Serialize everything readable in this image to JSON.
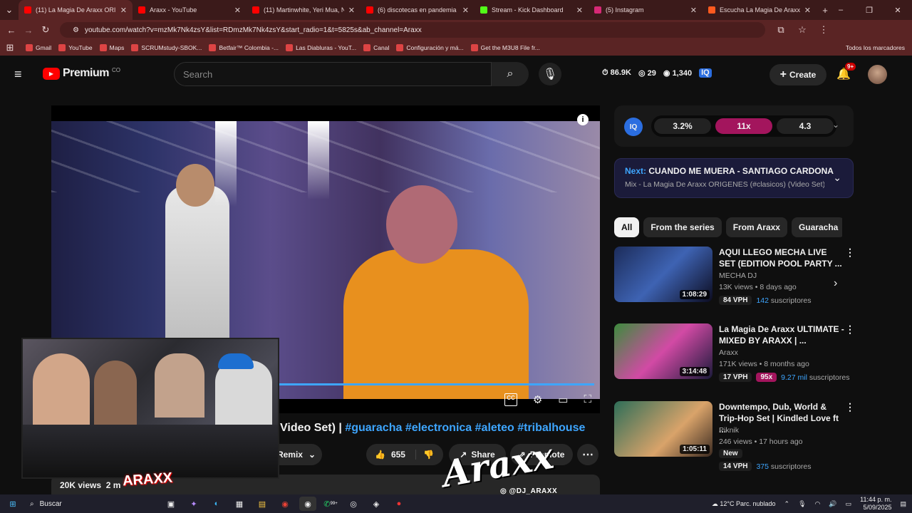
{
  "browser": {
    "tabs": [
      {
        "title": "(11) La Magia De Araxx ORI",
        "color": "#ff0000"
      },
      {
        "title": "Araxx - YouTube",
        "color": "#ff0000"
      },
      {
        "title": "(11) Martinwhite, Yeri Mua, NE",
        "color": "#ff0000"
      },
      {
        "title": "(6) discotecas en pandemia bo",
        "color": "#ff0000"
      },
      {
        "title": "Stream - Kick Dashboard",
        "color": "#53fc18"
      },
      {
        "title": "(5) Instagram",
        "color": "#d62976"
      },
      {
        "title": "Escucha La Magia De Araxx ULT",
        "color": "#ff5a1f"
      }
    ],
    "url": "youtube.com/watch?v=mzMk7Nk4zsY&list=RDmzMk7Nk4zsY&start_radio=1&t=5825s&ab_channel=Araxx",
    "bookmarks": [
      "Gmail",
      "YouTube",
      "Maps",
      "SCRUMstudy-SBOK...",
      "Betfair™ Colombia -...",
      "Las Diabluras - YouT...",
      "Canal",
      "Configuración y má...",
      "Get the M3U8 File fr..."
    ],
    "all_bookmarks": "Todos los marcadores"
  },
  "yt": {
    "logo": "Premium",
    "country": "CO",
    "search_placeholder": "Search",
    "stats": {
      "views": "86.9K",
      "likes": "29",
      "eye": "1,340"
    },
    "create": "Create",
    "notif": "9+"
  },
  "iq": {
    "badge": "IQ",
    "a": "3.2%",
    "b": "11x",
    "c": "4.3"
  },
  "next": {
    "label": "Next:",
    "title": "CUANDO ME MUERA - SANTIAGO CARDONA",
    "sub": "Mix - La Magia De Araxx ORIGENES (#clasicos) (Video Set) | ..."
  },
  "chips": [
    "All",
    "From the series",
    "From Araxx",
    "Guaracha"
  ],
  "video": {
    "title_tail": "Video Set) |",
    "hashtags": "#guaracha #electronica #aleteo #tribalhouse",
    "likes": "655",
    "share": "Share",
    "promote": "Promote",
    "remix": "Remix",
    "views": "20K views",
    "ago": "2 m",
    "watermark": "Araxx",
    "handle": "@DJ_ARAXX"
  },
  "recs": [
    {
      "title": "AQUI LLEGO MECHA LIVE SET (EDITION POOL PARTY ...",
      "channel": "MECHA DJ",
      "meta": "13K views • 8 days ago",
      "dur": "1:08:29",
      "vph": "84 VPH",
      "extra": "",
      "subs": "142",
      "subs_label": "suscriptores"
    },
    {
      "title": "La Magia De Araxx ULTIMATE - MIXED BY ARAXX | ...",
      "channel": "Araxx",
      "meta": "171K views • 8 months ago",
      "dur": "3:14:48",
      "vph": "17 VPH",
      "extra": "95x",
      "subs": "9.27 mil",
      "subs_label": "suscriptores"
    },
    {
      "title": "Downtempo, Dub, World & Trip-Hop Set | Kindled Love ft ...",
      "channel": "Piknik",
      "meta": "246 views • 17 hours ago",
      "dur": "1:05:11",
      "vph": "14 VPH",
      "extra": "New",
      "subs": "375",
      "subs_label": "suscriptores"
    }
  ],
  "taskbar": {
    "search": "Buscar",
    "weather": "12°C  Parc. nublado",
    "time": "11:44 p. m.",
    "date": "5/09/2025",
    "badge": "99+"
  }
}
